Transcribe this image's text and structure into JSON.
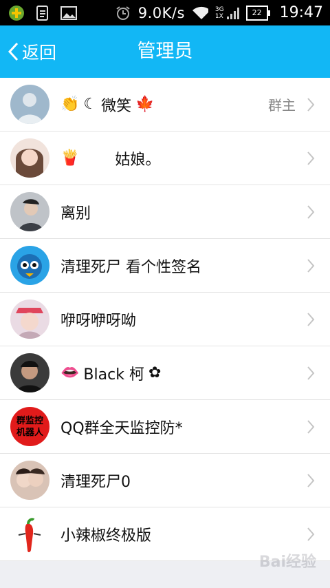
{
  "status_bar": {
    "net_speed": "9.0K/s",
    "signal_labels": [
      "3G",
      "1X"
    ],
    "battery": "22",
    "time": "19:47"
  },
  "nav": {
    "back_label": "返回",
    "title": "管理员"
  },
  "members": [
    {
      "name": "微笑",
      "role": "群主",
      "avatar_color": "#6d8aa6"
    },
    {
      "name": "姑娘。",
      "role": "",
      "avatar_color": "#e8c6b8"
    },
    {
      "name": "离别",
      "role": "",
      "avatar_color": "#8b8f96"
    },
    {
      "name": "清理死尸 看个性签名",
      "role": "",
      "avatar_color": "#2aa3e6"
    },
    {
      "name": "咿呀咿呀呦",
      "role": "",
      "avatar_color": "#d9a7b8"
    },
    {
      "name": "Black 柯",
      "role": "",
      "avatar_color": "#2b2b2b"
    },
    {
      "name": "QQ群全天监控防*",
      "role": "",
      "avatar_color": "#e11b1b"
    },
    {
      "name": "清理死尸0",
      "role": "",
      "avatar_color": "#c6a28e"
    },
    {
      "name": "小辣椒终极版",
      "role": "",
      "avatar_color": "#ffffff"
    }
  ],
  "avatar_texts": {
    "member_7": "群监控机器人"
  },
  "watermark": "Bai经验",
  "colors": {
    "nav": "#12b7f5",
    "role": "#888888",
    "chevron": "#c4c4c4"
  }
}
